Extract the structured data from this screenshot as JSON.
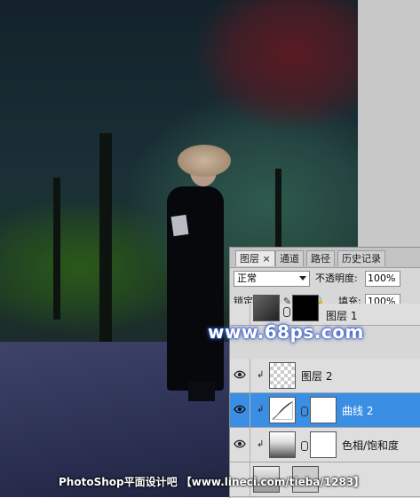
{
  "panel": {
    "tabs": [
      {
        "label": "图层 ×",
        "active": true
      },
      {
        "label": "通道",
        "active": false
      },
      {
        "label": "路径",
        "active": false
      },
      {
        "label": "历史记录",
        "active": false
      }
    ],
    "blend_mode": "正常",
    "opacity_label": "不透明度:",
    "opacity_value": "100%",
    "lock_label": "锁定:",
    "fill_label": "填充:",
    "fill_value": "100%",
    "lock_icons": [
      "transparency-lock-icon",
      "brush-lock-icon",
      "move-lock-icon",
      "padlock-icon"
    ],
    "layers": [
      {
        "name": "图层 1",
        "visible": false,
        "clipped": false,
        "selected": false,
        "thumb": "photo",
        "mask": "black"
      },
      {
        "name": "图层 2",
        "visible": true,
        "clipped": true,
        "selected": false,
        "thumb": "transparent",
        "mask": null
      },
      {
        "name": "曲线 2",
        "visible": true,
        "clipped": true,
        "selected": true,
        "thumb": "curves",
        "mask": "white"
      },
      {
        "name": "色相/饱和度",
        "visible": true,
        "clipped": true,
        "selected": false,
        "thumb": "hue-sat",
        "mask": "white"
      }
    ]
  },
  "watermark": {
    "site": "www.68ps.com",
    "footer": "PhotoShop平面设计吧 【www.lineci.com/tieba/1283】"
  },
  "colors": {
    "selection": "#3a8fe4",
    "watermark_glow": "#3a5ec8"
  }
}
